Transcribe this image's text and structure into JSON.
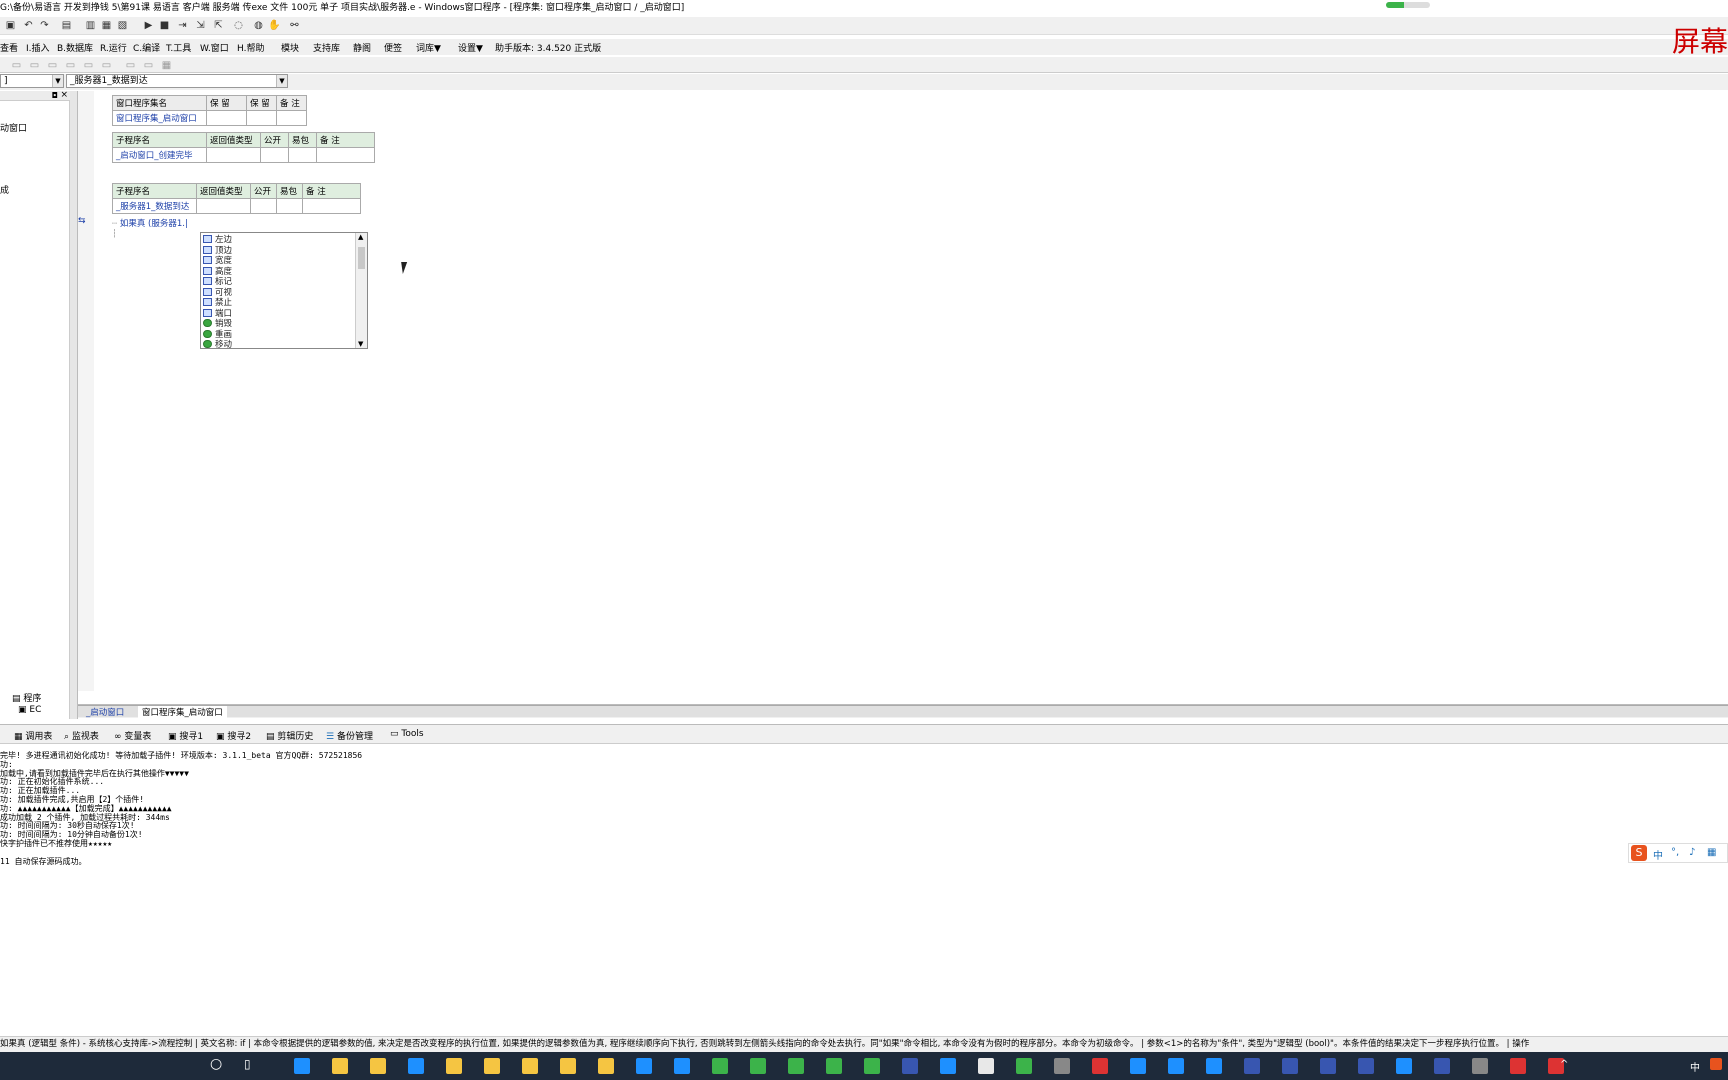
{
  "window": {
    "title": "G:\\备份\\易语言  开发到挣钱 5\\第91课   易语言  客户端  服务端 传exe 文件  100元 单子  项目实战\\服务器.e - Windows窗口程序 - [程序集: 窗口程序集_启动窗口 / _启动窗口]",
    "brand": "屏幕",
    "progress": 0.4
  },
  "menu": {
    "items": [
      "查看",
      "I.插入",
      "B.数据库",
      "R.运行",
      "C.编译",
      "T.工具",
      "W.窗口",
      "H.帮助",
      "模块",
      "支持库",
      "静阁",
      "便签",
      "词库▼",
      "设置▼",
      "助手版本: 3.4.520 正式版"
    ]
  },
  "selectors": {
    "left_value": "]",
    "right_value": "_服务器1_数据到达"
  },
  "table1": {
    "headers": [
      "窗口程序集名",
      "保 留",
      "保 留",
      "备 注"
    ],
    "row": [
      "窗口程序集_启动窗口",
      "",
      "",
      ""
    ]
  },
  "table2": {
    "headers": [
      "子程序名",
      "返回值类型",
      "公开",
      "易包",
      "备 注"
    ],
    "row": [
      "_启动窗口_创建完毕",
      "",
      "",
      "",
      ""
    ]
  },
  "table3": {
    "headers": [
      "子程序名",
      "返回值类型",
      "公开",
      "易包",
      "备 注"
    ],
    "row": [
      "_服务器1_数据到达",
      "",
      "",
      "",
      ""
    ]
  },
  "code": {
    "line": "如果真 (服务器1.|"
  },
  "popup": {
    "items": [
      {
        "label": "左边",
        "kind": "prop"
      },
      {
        "label": "顶边",
        "kind": "prop"
      },
      {
        "label": "宽度",
        "kind": "prop"
      },
      {
        "label": "高度",
        "kind": "prop"
      },
      {
        "label": "标记",
        "kind": "prop"
      },
      {
        "label": "可视",
        "kind": "prop"
      },
      {
        "label": "禁止",
        "kind": "prop"
      },
      {
        "label": "端口",
        "kind": "prop"
      },
      {
        "label": "销毁",
        "kind": "meth"
      },
      {
        "label": "重画",
        "kind": "meth"
      },
      {
        "label": "移动",
        "kind": "meth"
      }
    ]
  },
  "left_panel": {
    "item1": "动窗口",
    "item2": "成",
    "tab_program": "程序",
    "tab_ec": "EC"
  },
  "doc_tabs": {
    "tab1": "_启动窗口",
    "tab2": "窗口程序集_启动窗口"
  },
  "bottom_tabs": [
    "调用表",
    "监视表",
    "变量表",
    "搜寻1",
    "搜寻2",
    "剪辑历史",
    "备份管理",
    "Tools"
  ],
  "output_lines": [
    "完毕!  多进程通讯初始化成功!  等待加载子插件!  环境版本: 3.1.1_beta 官方QQ群: 572521856",
    "功:",
    "加载中,请看到加载插件完毕后在执行其他操作▼▼▼▼▼",
    "功: 正在初始化插件系统...",
    "功: 正在加载插件...",
    "功: 加载插件完成,共启用【2】个插件!",
    "功: ▲▲▲▲▲▲▲▲▲▲▲【加载完成】▲▲▲▲▲▲▲▲▲▲▲",
    " 成功加载 2 个插件, 加载过程共耗时: 344ms",
    "功: 时间间隔为: 30秒自动保存1次!",
    "功: 时间间隔为: 10分钟自动备份1次!",
    "快字护插件已不推荐使用★★★★★",
    "",
    "11 自动保存源码成功。"
  ],
  "status": {
    "text": "如果真 (逻辑型 条件) - 系统核心支持库->流程控制  |  英文名称: if  |  本命令根据提供的逻辑参数的值, 来决定是否改变程序的执行位置, 如果提供的逻辑参数值为真, 程序继续顺序向下执行, 否则跳转到左侧箭头线指向的命令处去执行。同\"如果\"命令相比, 本命令没有为假时的程序部分。本命令为初级命令。  |  参数<1>的名称为\"条件\", 类型为\"逻辑型 (bool)\"。本条件值的结果决定下一步程序执行位置。  |  操作"
  },
  "ime": {
    "mode": "中"
  },
  "tray": {
    "lang": "中"
  }
}
